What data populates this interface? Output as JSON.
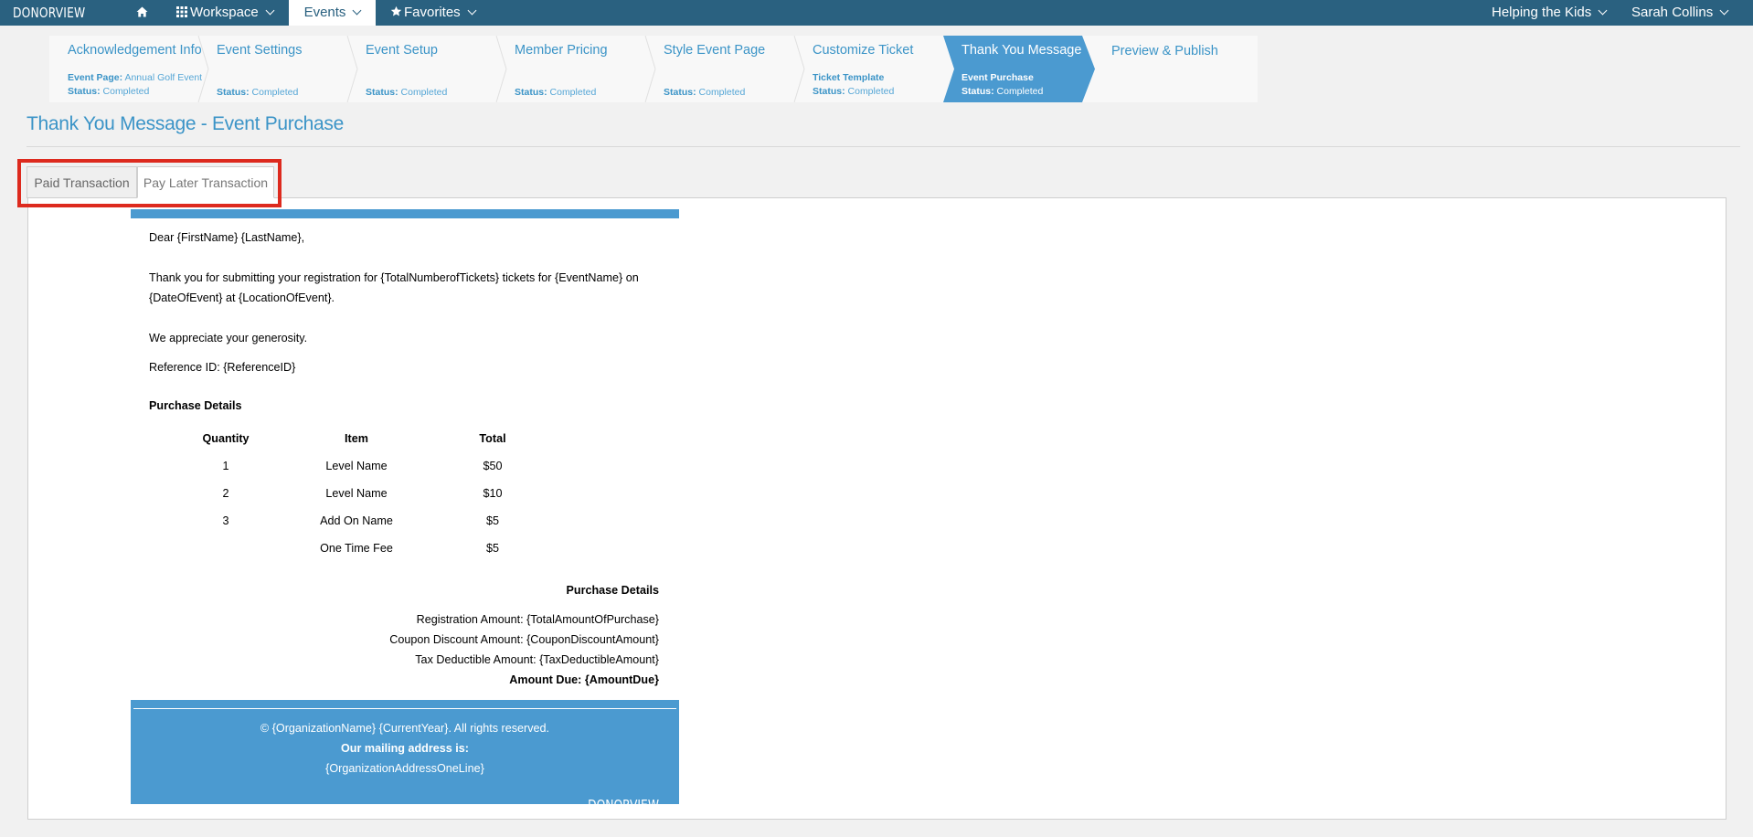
{
  "app": {
    "brand": "DONORVIEW"
  },
  "topnav": {
    "home_icon": "home-icon",
    "workspace": "Workspace",
    "events": "Events",
    "favorites": "Favorites",
    "organization": "Helping the Kids",
    "user": "Sarah Collins"
  },
  "steps": [
    {
      "title": "Acknowledgement Info",
      "line1_label": "Event Page:",
      "line1_value": "Annual Golf Event",
      "status_label": "Status:",
      "status": "Completed"
    },
    {
      "title": "Event Settings",
      "status_label": "Status:",
      "status": "Completed"
    },
    {
      "title": "Event Setup",
      "status_label": "Status:",
      "status": "Completed"
    },
    {
      "title": "Member Pricing",
      "status_label": "Status:",
      "status": "Completed"
    },
    {
      "title": "Style Event Page",
      "status_label": "Status:",
      "status": "Completed"
    },
    {
      "title": "Customize Ticket",
      "line1_label": "Ticket Template",
      "status_label": "Status:",
      "status": "Completed"
    },
    {
      "title": "Thank You Message",
      "line1_label": "Event Purchase",
      "status_label": "Status:",
      "status": "Completed"
    },
    {
      "title": "Preview & Publish"
    }
  ],
  "page_title": "Thank You Message - Event Purchase",
  "tabs": {
    "paid": "Paid Transaction",
    "pay_later": "Pay Later Transaction"
  },
  "email": {
    "greeting": "Dear {FirstName} {LastName},",
    "body_line1": "Thank you for submitting your registration for {TotalNumberofTickets} tickets for {EventName} on",
    "body_line2": "{DateOfEvent} at {LocationOfEvent}.",
    "appreciation": "We appreciate your generosity.",
    "reference": "Reference ID: {ReferenceID}",
    "purchase_heading": "Purchase Details",
    "table": {
      "headers": [
        "Quantity",
        "Item",
        "Total"
      ],
      "rows": [
        [
          "1",
          "Level Name",
          "$50"
        ],
        [
          "2",
          "Level Name",
          "$10"
        ],
        [
          "3",
          "Add On Name",
          "$5"
        ],
        [
          "",
          "One Time Fee",
          "$5"
        ]
      ]
    },
    "summary_heading": "Purchase Details",
    "registration_amount": "Registration Amount: {TotalAmountOfPurchase}",
    "coupon_discount": "Coupon Discount Amount: {CouponDiscountAmount}",
    "tax_deductible": "Tax Deductible Amount: {TaxDeductibleAmount}",
    "amount_due": "Amount Due: {AmountDue}",
    "footer": {
      "copyright": "© {OrganizationName} {CurrentYear}. All rights reserved.",
      "mailing_label": "Our mailing address is:",
      "address": "{OrganizationAddressOneLine}",
      "logo": "DONORVIEW"
    }
  },
  "colors": {
    "nav": "#2a6180",
    "accent": "#3b94c7",
    "step_current": "#4b9ad0",
    "highlight": "#dd2a1e"
  }
}
